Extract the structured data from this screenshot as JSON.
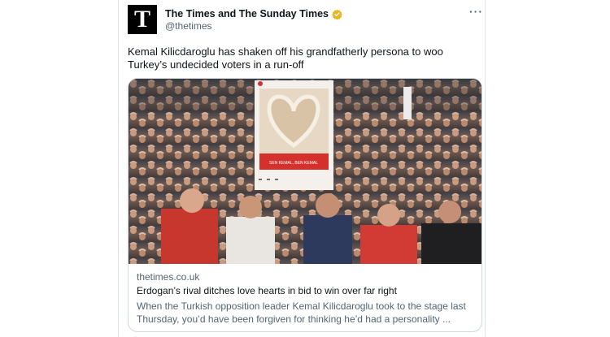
{
  "tweet": {
    "avatar_letter": "T",
    "display_name": "The Times and The Sunday Times",
    "handle": "@thetimes",
    "more_glyph": "···",
    "text": "Kemal Kilicdaroglu has shaken off his grandfatherly persona to woo Turkey’s undecided voters in a run-off"
  },
  "card": {
    "image_icon": "crowd-heart-photo",
    "domain": "thetimes.co.uk",
    "headline": "Erdogan’s rival ditches love hearts in bid to win over far right",
    "description": "When the Turkish opposition leader Kemal Kilicdaroglu took to the stage last Thursday, you’d have been forgiven for thinking he’d had a personality ..."
  },
  "colors": {
    "verified_badge": "#e8b623",
    "text_primary": "#0f1419",
    "text_secondary": "#536471",
    "border": "#cfd9de"
  }
}
